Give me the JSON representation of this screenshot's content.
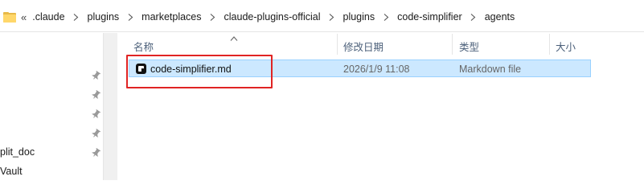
{
  "address_bar": {
    "overflow": "«",
    "crumbs": [
      ".claude",
      "plugins",
      "marketplaces",
      "claude-plugins-official",
      "plugins",
      "code-simplifier",
      "agents"
    ]
  },
  "nav": {
    "items": [
      "plit_doc",
      "Vault"
    ]
  },
  "columns": {
    "name": "名称",
    "modified": "修改日期",
    "type": "类型",
    "size": "大小"
  },
  "files": [
    {
      "name": "code-simplifier.md",
      "modified": "2026/1/9 11:08",
      "type": "Markdown file",
      "size": ""
    }
  ],
  "colors": {
    "selection": "#cce8ff",
    "selection_border": "#99d1ff",
    "annotation": "#e02424",
    "folder": "#ffd76a"
  }
}
